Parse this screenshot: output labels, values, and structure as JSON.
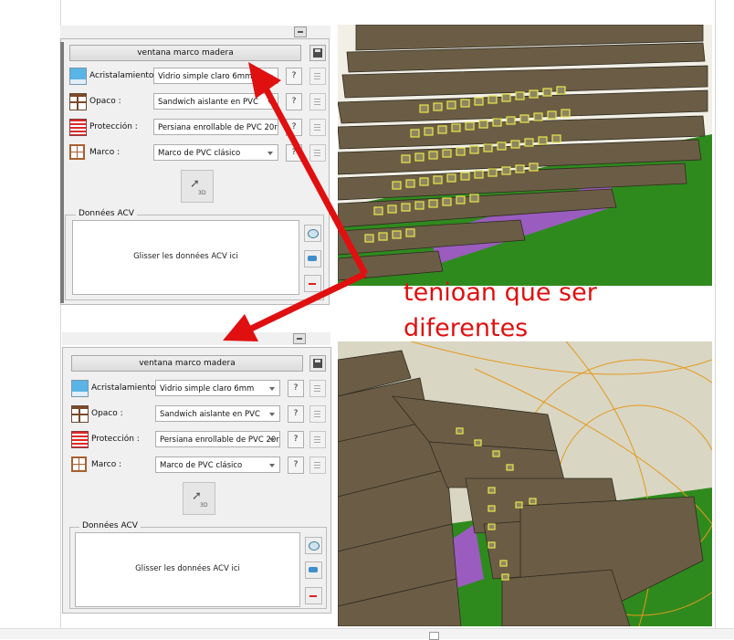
{
  "panels": [
    {
      "title": "ventana marco madera",
      "rows": [
        {
          "label": "Acristalamiento :",
          "value": "Vidrio simple claro 6mm",
          "icon": "glazing-icon",
          "color": "#5ab4e6"
        },
        {
          "label": "Opaco :",
          "value": "Sandwich aislante en PVC",
          "icon": "opaque-icon",
          "color": "#7a4a2a"
        },
        {
          "label": "Protección :",
          "value": "Persiana enrollable de PVC 20r",
          "icon": "shutter-icon",
          "color": "#d92a2a"
        },
        {
          "label": "Marco :",
          "value": "Marco de PVC clásico",
          "icon": "frame-icon",
          "color": "#a86030"
        }
      ],
      "q_label": "?",
      "btn_3d_label": "3D",
      "acv_legend": "Données ACV",
      "acv_drop_text": "Glisser les données ACV ici"
    },
    {
      "title": "ventana marco madera",
      "rows": [
        {
          "label": "Acristalamiento :",
          "value": "Vidrio simple claro 6mm",
          "icon": "glazing-icon",
          "color": "#5ab4e6"
        },
        {
          "label": "Opaco :",
          "value": "Sandwich aislante en PVC",
          "icon": "opaque-icon",
          "color": "#7a4a2a"
        },
        {
          "label": "Protección :",
          "value": "Persiana enrollable de PVC 20r",
          "icon": "shutter-icon",
          "color": "#d92a2a"
        },
        {
          "label": "Marco :",
          "value": "Marco de PVC clásico",
          "icon": "frame-icon",
          "color": "#a86030"
        }
      ],
      "q_label": "?",
      "btn_3d_label": "3D",
      "acv_legend": "Données ACV",
      "acv_drop_text": "Glisser les données ACV ici"
    }
  ],
  "annotation": {
    "line1": "tenioan que ser",
    "line2": "diferentes",
    "color": "#e01010"
  },
  "colors": {
    "building": "#6b5d45",
    "window_highlight": "#e8e84a",
    "ground": "#2f8a1e",
    "purple_base": "#9a5cbf",
    "sky": "#f1efe6"
  }
}
